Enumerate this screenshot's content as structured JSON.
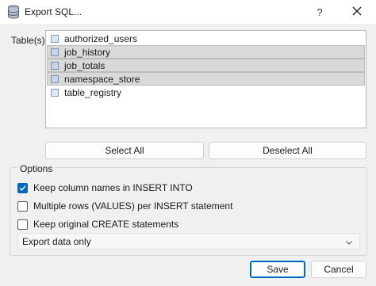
{
  "window": {
    "title": "Export SQL...",
    "help_label": "?",
    "icons": {
      "app": "database-icon",
      "close": "close-icon"
    }
  },
  "tables": {
    "label": "Table(s)",
    "items": [
      {
        "name": "authorized_users",
        "selected": false
      },
      {
        "name": "job_history",
        "selected": true
      },
      {
        "name": "job_totals",
        "selected": true
      },
      {
        "name": "namespace_store",
        "selected": true
      },
      {
        "name": "table_registry",
        "selected": false
      }
    ],
    "select_all_label": "Select All",
    "deselect_all_label": "Deselect All"
  },
  "options": {
    "label": "Options",
    "keep_column_names": {
      "label": "Keep column names in INSERT INTO",
      "checked": true
    },
    "multiple_rows": {
      "label": "Multiple rows (VALUES) per INSERT statement",
      "checked": false
    },
    "keep_create": {
      "label": "Keep original CREATE statements",
      "checked": false
    },
    "export_mode": {
      "selected": "Export data only"
    }
  },
  "footer": {
    "save_label": "Save",
    "cancel_label": "Cancel"
  },
  "colors": {
    "accent": "#0067c0",
    "close_x": "#c42b1c"
  }
}
